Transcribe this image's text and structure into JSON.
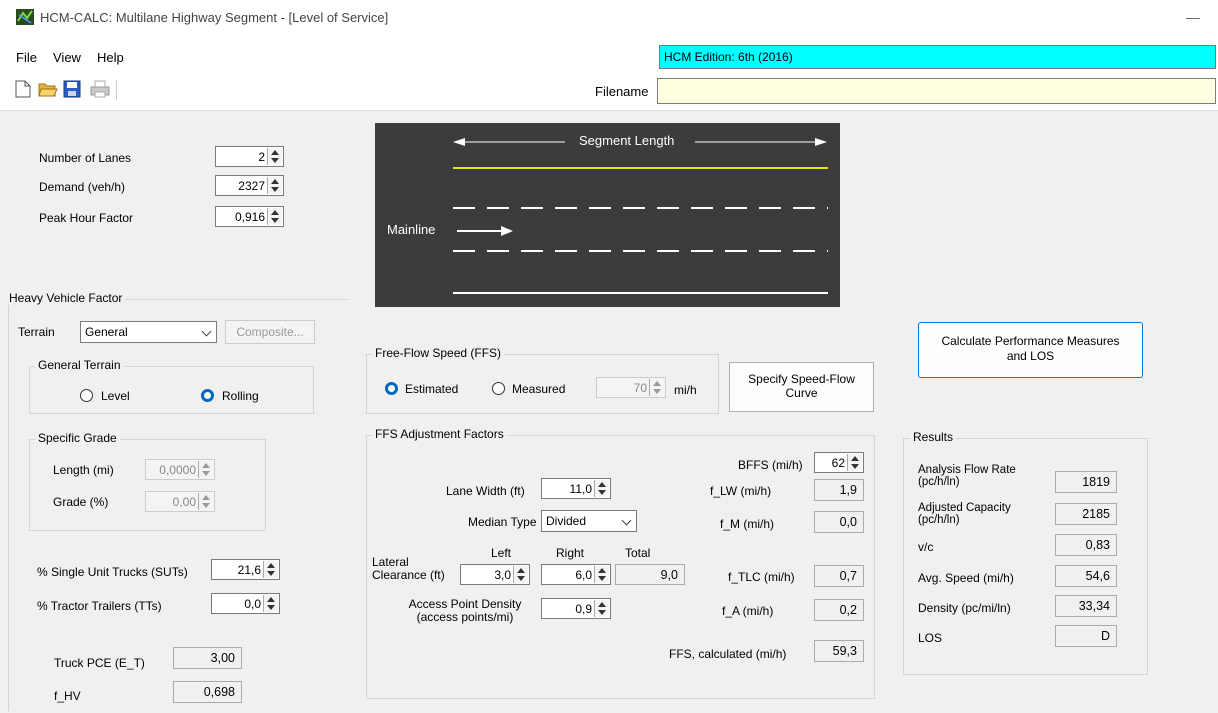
{
  "window": {
    "title": "HCM-CALC: Multilane Highway Segment - [Level of Service]",
    "minimize": "—"
  },
  "menu": {
    "file": "File",
    "view": "View",
    "help": "Help"
  },
  "hcm_edition": "HCM Edition: 6th (2016)",
  "filename": {
    "label": "Filename",
    "value": ""
  },
  "inputs": {
    "lanes": {
      "label": "Number of Lanes",
      "value": "2"
    },
    "demand": {
      "label": "Demand (veh/h)",
      "value": "2327"
    },
    "phf": {
      "label": "Peak Hour Factor",
      "value": "0,916"
    }
  },
  "heavy_vehicle": {
    "title": "Heavy Vehicle Factor",
    "terrain_label": "Terrain",
    "terrain_value": "General",
    "composite_button": "Composite...",
    "general_terrain": {
      "title": "General Terrain",
      "level": "Level",
      "rolling": "Rolling"
    },
    "specific_grade": {
      "title": "Specific Grade",
      "length_label": "Length (mi)",
      "length_value": "0,0000",
      "grade_label": "Grade (%)",
      "grade_value": "0,00"
    },
    "sut_label": "% Single Unit Trucks (SUTs)",
    "sut_value": "21,6",
    "tt_label": "% Tractor Trailers (TTs)",
    "tt_value": "0,0",
    "pce_label": "Truck PCE (E_T)",
    "pce_value": "3,00",
    "fhv_label": "f_HV",
    "fhv_value": "0,698"
  },
  "diagram": {
    "segment_length": "Segment Length",
    "mainline": "Mainline"
  },
  "ffs": {
    "title": "Free-Flow Speed (FFS)",
    "estimated": "Estimated",
    "measured": "Measured",
    "measured_value": "70",
    "unit": "mi/h",
    "speed_flow_button": "Specify Speed-Flow Curve"
  },
  "adjust": {
    "title": "FFS Adjustment Factors",
    "lane_width_label": "Lane Width (ft)",
    "lane_width_value": "11,0",
    "median_label": "Median Type",
    "median_value": "Divided",
    "lateral_label": "Lateral Clearance (ft)",
    "left_label": "Left",
    "right_label": "Right",
    "total_label": "Total",
    "left_value": "3,0",
    "right_value": "6,0",
    "total_value": "9,0",
    "access_label": "Access Point Density (access points/mi)",
    "access_value": "0,9",
    "bffs_label": "BFFS (mi/h)",
    "bffs_value": "62",
    "flw_label": "f_LW (mi/h)",
    "flw_value": "1,9",
    "fm_label": "f_M (mi/h)",
    "fm_value": "0,0",
    "ftlc_label": "f_TLC (mi/h)",
    "ftlc_value": "0,7",
    "fa_label": "f_A (mi/h)",
    "fa_value": "0,2",
    "ffs_calc_label": "FFS, calculated (mi/h)",
    "ffs_calc_value": "59,3"
  },
  "calculate_button": "Calculate Performance Measures and LOS",
  "results": {
    "title": "Results",
    "flow_label": "Analysis Flow Rate (pc/h/ln)",
    "flow_value": "1819",
    "capacity_label": "Adjusted Capacity (pc/h/ln)",
    "capacity_value": "2185",
    "vc_label": "v/c",
    "vc_value": "0,83",
    "speed_label": "Avg. Speed (mi/h)",
    "speed_value": "54,6",
    "density_label": "Density (pc/mi/ln)",
    "density_value": "33,34",
    "los_label": "LOS",
    "los_value": "D"
  },
  "icons": [
    "app-icon",
    "new-file-icon",
    "open-folder-icon",
    "save-icon",
    "print-icon"
  ],
  "colors": {
    "edition_bg": "#00ffff",
    "filename_bg": "#ffffe1",
    "radio_selected": "#0067c0",
    "lane_line": "#e6e600",
    "diagram_bg": "#3c3c3c"
  }
}
